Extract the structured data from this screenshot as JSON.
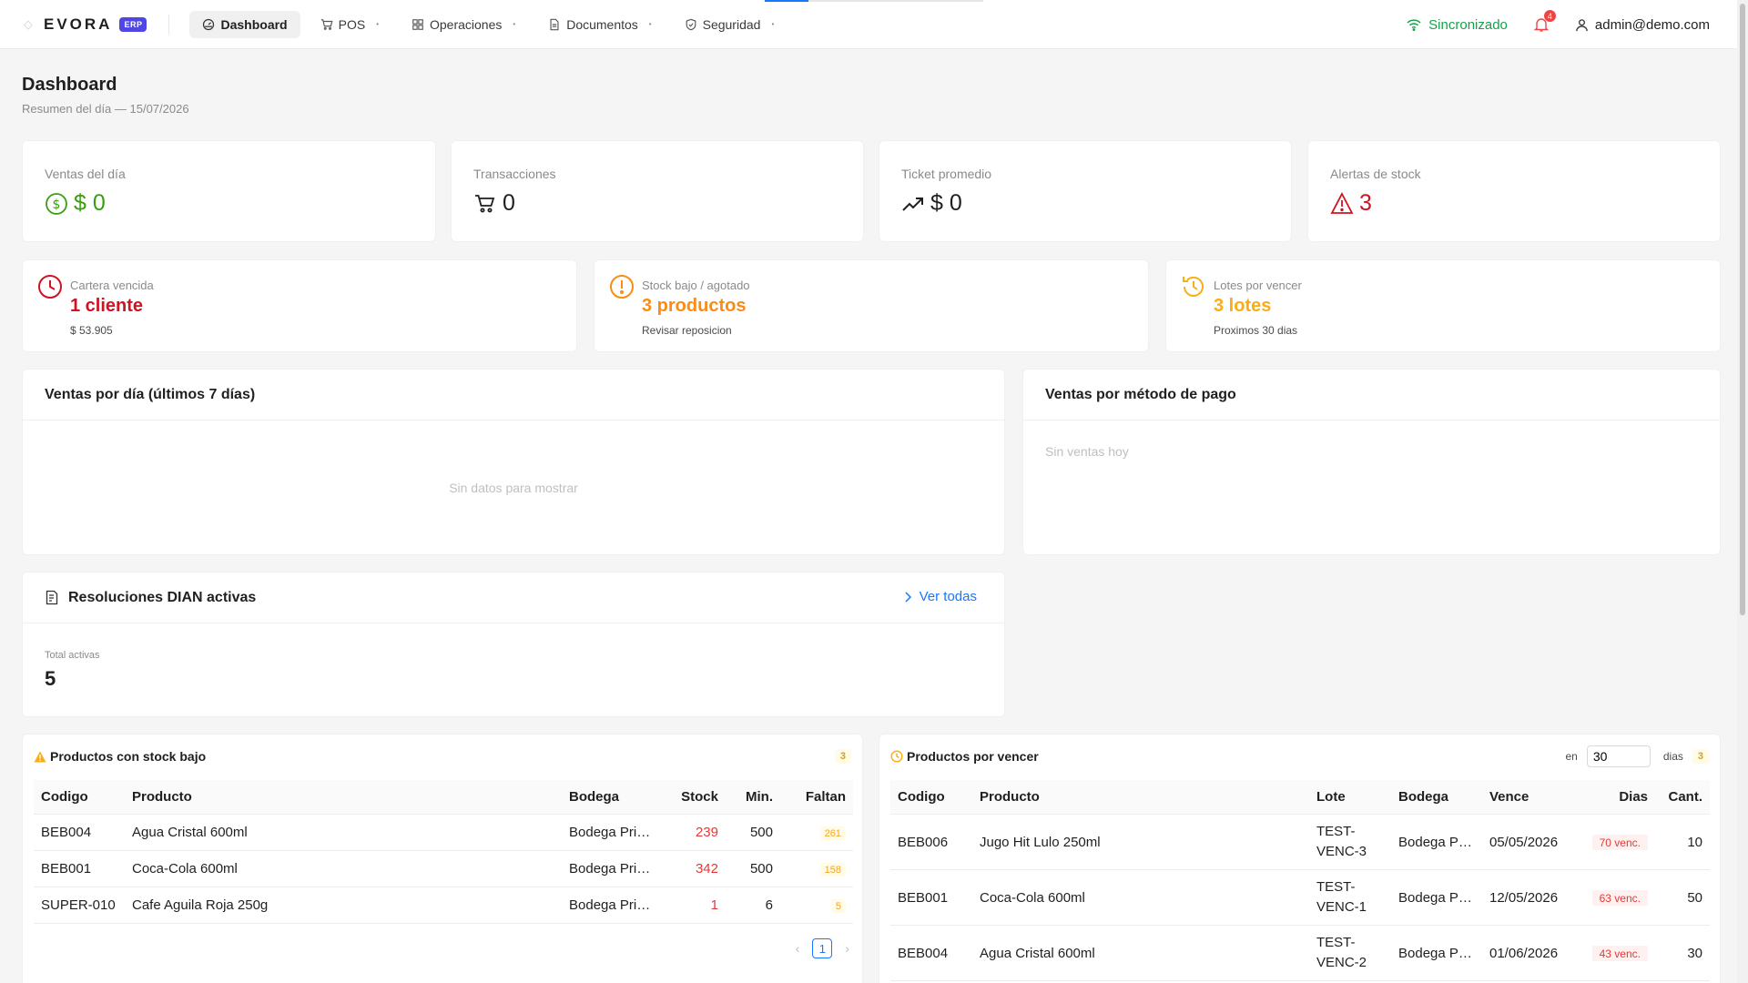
{
  "app": {
    "logo_text": "EVORA",
    "logo_badge": "ERP"
  },
  "nav": {
    "items": [
      {
        "label": "Dashboard",
        "icon": "dashboard-icon",
        "active": true
      },
      {
        "label": "POS",
        "icon": "cart-icon"
      },
      {
        "label": "Operaciones",
        "icon": "grid-icon"
      },
      {
        "label": "Documentos",
        "icon": "document-icon"
      },
      {
        "label": "Seguridad",
        "icon": "shield-icon"
      }
    ],
    "sync_label": "Sincronizado",
    "notifications_count": "4",
    "user_email": "admin@demo.com"
  },
  "header": {
    "title": "Dashboard",
    "subtitle": "Resumen del día — 15/07/2026"
  },
  "kpis": [
    {
      "label": "Ventas del día",
      "value": "$ 0",
      "icon": "dollar-circle-icon",
      "color": "#389e0d"
    },
    {
      "label": "Transacciones",
      "value": "0",
      "icon": "cart-icon",
      "color": "#1f1f1f"
    },
    {
      "label": "Ticket promedio",
      "value": "$ 0",
      "icon": "trend-up-icon",
      "color": "#1f1f1f"
    },
    {
      "label": "Alertas de stock",
      "value": "3",
      "icon": "warning-icon",
      "color": "#cf1322"
    }
  ],
  "alerts": [
    {
      "label": "Cartera vencida",
      "value": "1 cliente",
      "sub": "$ 53.905",
      "icon": "clock-icon",
      "color": "#cf1322"
    },
    {
      "label": "Stock bajo / agotado",
      "value": "3 productos",
      "sub": "Revisar reposicion",
      "icon": "exclamation-circle-icon",
      "color": "#fa8c16"
    },
    {
      "label": "Lotes por vencer",
      "value": "3 lotes",
      "sub": "Proximos 30 dias",
      "icon": "history-icon",
      "color": "#faad14"
    }
  ],
  "panels": {
    "sales_by_day": {
      "title": "Ventas por día (últimos 7 días)",
      "empty": "Sin datos para mostrar"
    },
    "sales_by_method": {
      "title": "Ventas por método de pago",
      "empty": "Sin ventas hoy"
    },
    "dian": {
      "title": "Resoluciones DIAN activas",
      "link": "Ver todas",
      "total_label": "Total activas",
      "total_value": "5"
    }
  },
  "low_stock": {
    "title": "Productos con stock bajo",
    "count": "3",
    "columns": [
      "Codigo",
      "Producto",
      "Bodega",
      "Stock",
      "Min.",
      "Faltan"
    ],
    "rows": [
      {
        "codigo": "BEB004",
        "producto": "Agua Cristal 600ml",
        "bodega": "Bodega Principal",
        "stock": "239",
        "min": "500",
        "faltan": "261"
      },
      {
        "codigo": "BEB001",
        "producto": "Coca-Cola 600ml",
        "bodega": "Bodega Principal",
        "stock": "342",
        "min": "500",
        "faltan": "158"
      },
      {
        "codigo": "SUPER-010",
        "producto": "Cafe Aguila Roja 250g",
        "bodega": "Bodega Principal",
        "stock": "1",
        "min": "6",
        "faltan": "5"
      }
    ],
    "page": "1"
  },
  "expiring": {
    "title": "Productos por vencer",
    "in_label": "en",
    "days_value": "30",
    "days_label": "dias",
    "count": "3",
    "columns": [
      "Codigo",
      "Producto",
      "Lote",
      "Bodega",
      "Vence",
      "Dias",
      "Cant."
    ],
    "rows": [
      {
        "codigo": "BEB006",
        "producto": "Jugo Hit Lulo 250ml",
        "lote": "TEST-VENC-3",
        "bodega": "Bodega Principal",
        "vence": "05/05/2026",
        "dias": "70 venc.",
        "cant": "10"
      },
      {
        "codigo": "BEB001",
        "producto": "Coca-Cola 600ml",
        "lote": "TEST-VENC-1",
        "bodega": "Bodega Principal",
        "vence": "12/05/2026",
        "dias": "63 venc.",
        "cant": "50"
      },
      {
        "codigo": "BEB004",
        "producto": "Agua Cristal 600ml",
        "lote": "TEST-VENC-2",
        "bodega": "Bodega Principal",
        "vence": "01/06/2026",
        "dias": "43 venc.",
        "cant": "30"
      }
    ]
  }
}
